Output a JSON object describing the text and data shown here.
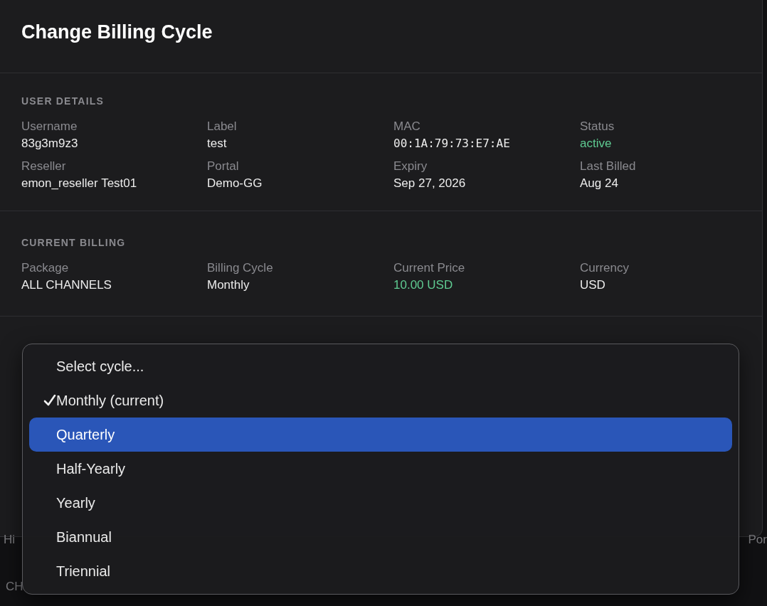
{
  "dialog": {
    "title": "Change Billing Cycle",
    "sections": [
      {
        "heading": "USER DETAILS",
        "fields": [
          {
            "label": "Username",
            "value": "83g3m9z3",
            "kind": "plain"
          },
          {
            "label": "Label",
            "value": "test",
            "kind": "plain"
          },
          {
            "label": "MAC",
            "value": "00:1A:79:73:E7:AE",
            "kind": "mono"
          },
          {
            "label": "Status",
            "value": "active",
            "kind": "accent"
          },
          {
            "label": "Reseller",
            "value": "emon_reseller Test01",
            "kind": "plain"
          },
          {
            "label": "Portal",
            "value": "Demo-GG",
            "kind": "plain"
          },
          {
            "label": "Expiry",
            "value": "Sep 27, 2026",
            "kind": "plain"
          },
          {
            "label": "Last Billed",
            "value": "Aug 24",
            "kind": "plain"
          }
        ]
      },
      {
        "heading": "CURRENT BILLING",
        "fields": [
          {
            "label": "Package",
            "value": "ALL CHANNELS",
            "kind": "plain"
          },
          {
            "label": "Billing Cycle",
            "value": "Monthly",
            "kind": "plain"
          },
          {
            "label": "Current Price",
            "value": "10.00 USD",
            "kind": "accent"
          },
          {
            "label": "Currency",
            "value": "USD",
            "kind": "plain"
          }
        ]
      }
    ]
  },
  "cycle_menu": {
    "options": [
      {
        "label": "Select cycle...",
        "checked": false,
        "selected": false
      },
      {
        "label": "Monthly (current)",
        "checked": true,
        "selected": false
      },
      {
        "label": "Quarterly",
        "checked": false,
        "selected": true
      },
      {
        "label": "Half-Yearly",
        "checked": false,
        "selected": false
      },
      {
        "label": "Yearly",
        "checked": false,
        "selected": false
      },
      {
        "label": "Biannual",
        "checked": false,
        "selected": false
      },
      {
        "label": "Triennial",
        "checked": false,
        "selected": false
      }
    ]
  },
  "background_fragments": {
    "left": "Hi",
    "right": "Por",
    "bottom": "CH"
  }
}
